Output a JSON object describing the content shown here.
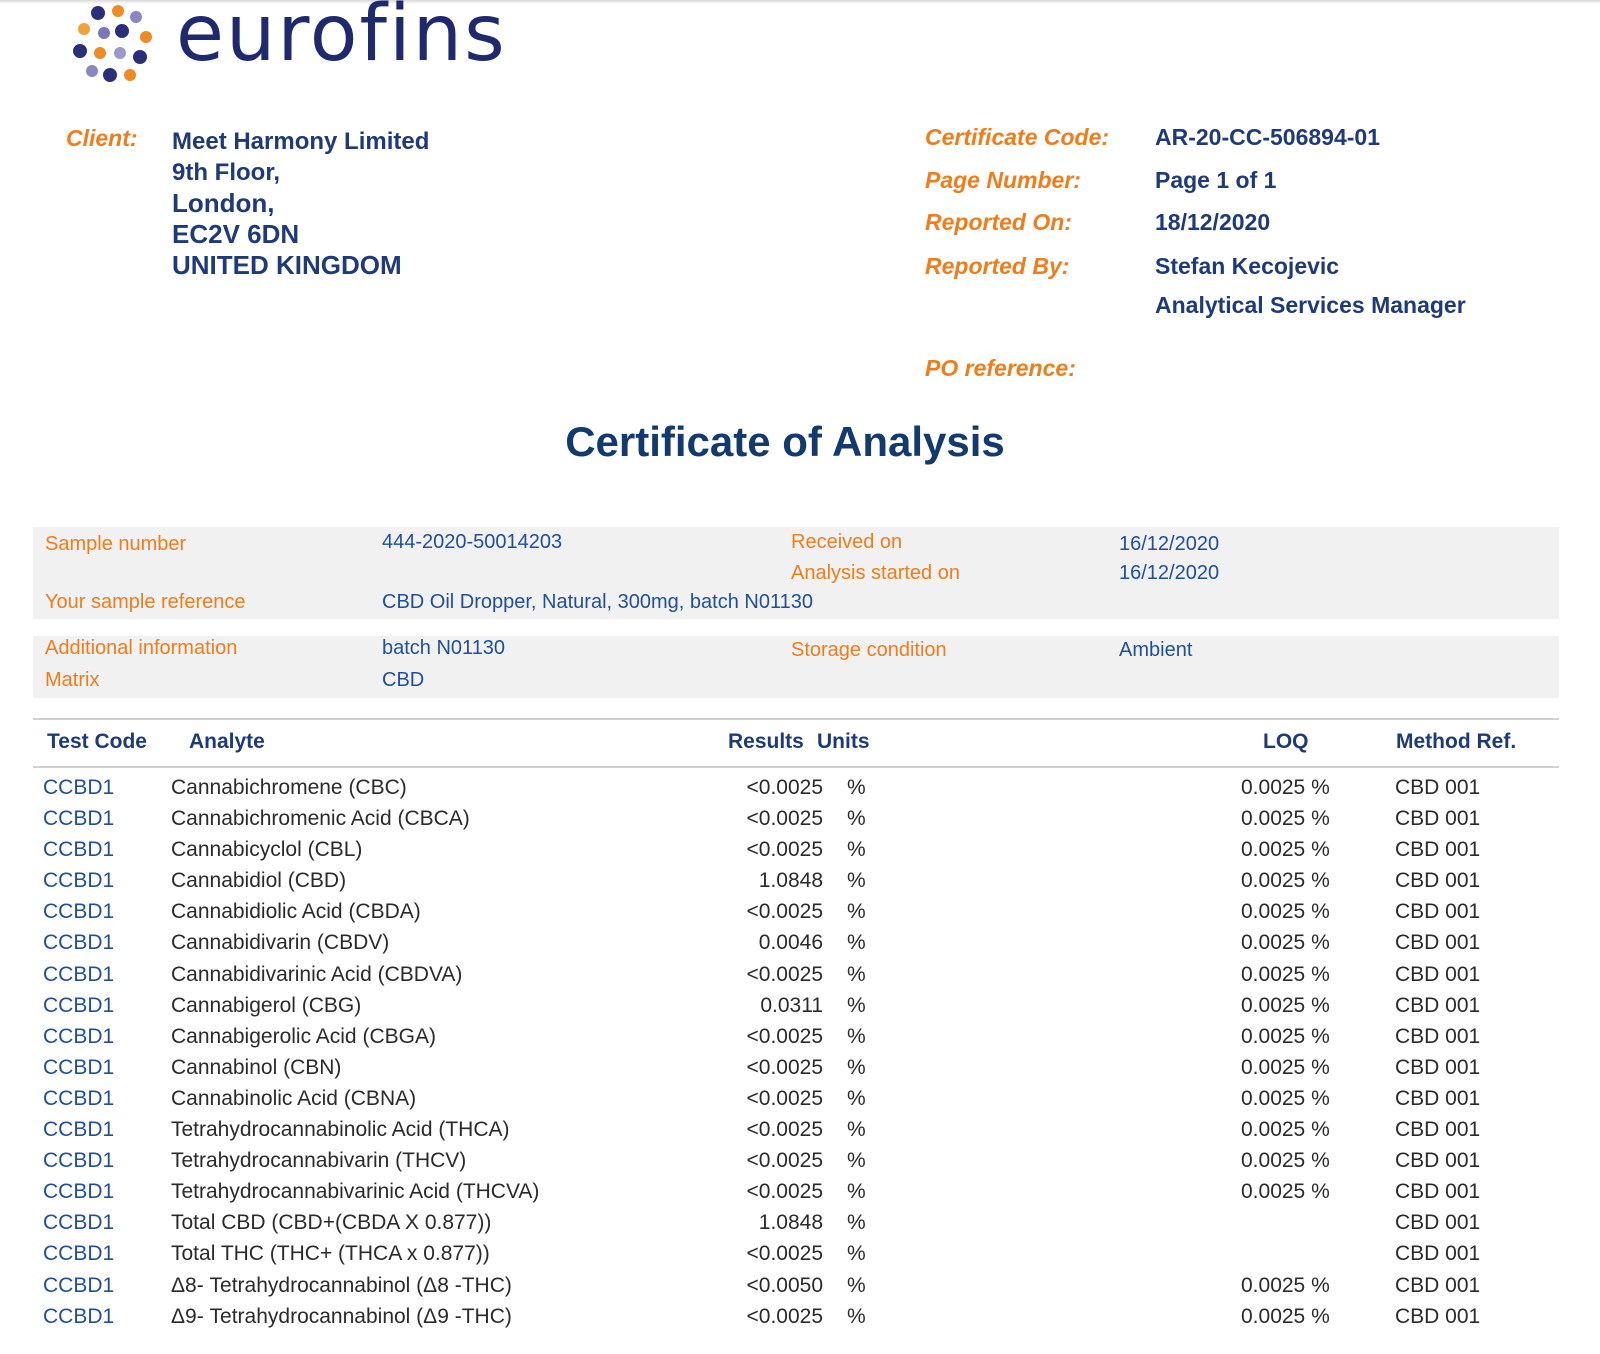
{
  "logo": {
    "text": "eurofins"
  },
  "client": {
    "label": "Client:",
    "lines": [
      "Meet Harmony Limited",
      "9th Floor,",
      "London,",
      "EC2V 6DN",
      "UNITED KINGDOM"
    ]
  },
  "certificate": {
    "code_label": "Certificate Code:",
    "code": "AR-20-CC-506894-01",
    "page_label": "Page Number:",
    "page": "Page 1 of 1",
    "reported_on_label": "Reported On:",
    "reported_on": "18/12/2020",
    "reported_by_label": "Reported By:",
    "reported_by": "Stefan Kecojevic",
    "reported_by_role": "Analytical Services Manager",
    "po_label": "PO reference:"
  },
  "title": "Certificate of Analysis",
  "sample": {
    "number_label": "Sample number",
    "number": "444-2020-50014203",
    "received_label": "Received on",
    "received": "16/12/2020",
    "started_label": "Analysis started on",
    "started": "16/12/2020",
    "reference_label": "Your sample reference",
    "reference": "CBD Oil Dropper, Natural, 300mg, batch N01130",
    "additional_label": "Additional information",
    "additional": "batch N01130",
    "storage_label": "Storage condition",
    "storage": "Ambient",
    "matrix_label": "Matrix",
    "matrix": "CBD"
  },
  "table": {
    "headers": {
      "test_code": "Test Code",
      "analyte": "Analyte",
      "results": "Results",
      "units": "Units",
      "loq": "LOQ",
      "method": "Method Ref."
    },
    "rows": [
      {
        "code": "CCBD1",
        "analyte": "Cannabichromene (CBC)",
        "result": "<0.0025",
        "unit": "%",
        "loq": "0.0025 %",
        "method": "CBD 001"
      },
      {
        "code": "CCBD1",
        "analyte": "Cannabichromenic Acid (CBCA)",
        "result": "<0.0025",
        "unit": "%",
        "loq": "0.0025 %",
        "method": "CBD 001"
      },
      {
        "code": "CCBD1",
        "analyte": "Cannabicyclol (CBL)",
        "result": "<0.0025",
        "unit": "%",
        "loq": "0.0025 %",
        "method": "CBD 001"
      },
      {
        "code": "CCBD1",
        "analyte": "Cannabidiol (CBD)",
        "result": "1.0848",
        "unit": "%",
        "loq": "0.0025 %",
        "method": "CBD 001"
      },
      {
        "code": "CCBD1",
        "analyte": "Cannabidiolic Acid (CBDA)",
        "result": "<0.0025",
        "unit": "%",
        "loq": "0.0025 %",
        "method": "CBD 001"
      },
      {
        "code": "CCBD1",
        "analyte": "Cannabidivarin (CBDV)",
        "result": "0.0046",
        "unit": "%",
        "loq": "0.0025 %",
        "method": "CBD 001"
      },
      {
        "code": "CCBD1",
        "analyte": "Cannabidivarinic Acid (CBDVA)",
        "result": "<0.0025",
        "unit": "%",
        "loq": "0.0025 %",
        "method": "CBD 001"
      },
      {
        "code": "CCBD1",
        "analyte": "Cannabigerol (CBG)",
        "result": "0.0311",
        "unit": "%",
        "loq": "0.0025 %",
        "method": "CBD 001"
      },
      {
        "code": "CCBD1",
        "analyte": "Cannabigerolic Acid (CBGA)",
        "result": "<0.0025",
        "unit": "%",
        "loq": "0.0025 %",
        "method": "CBD 001"
      },
      {
        "code": "CCBD1",
        "analyte": "Cannabinol (CBN)",
        "result": "<0.0025",
        "unit": "%",
        "loq": "0.0025 %",
        "method": "CBD 001"
      },
      {
        "code": "CCBD1",
        "analyte": "Cannabinolic Acid (CBNA)",
        "result": "<0.0025",
        "unit": "%",
        "loq": "0.0025 %",
        "method": "CBD 001"
      },
      {
        "code": "CCBD1",
        "analyte": "Tetrahydrocannabinolic Acid (THCA)",
        "result": "<0.0025",
        "unit": "%",
        "loq": "0.0025 %",
        "method": "CBD 001"
      },
      {
        "code": "CCBD1",
        "analyte": "Tetrahydrocannabivarin (THCV)",
        "result": "<0.0025",
        "unit": "%",
        "loq": "0.0025 %",
        "method": "CBD 001"
      },
      {
        "code": "CCBD1",
        "analyte": "Tetrahydrocannabivarinic Acid (THCVA)",
        "result": "<0.0025",
        "unit": "%",
        "loq": "0.0025 %",
        "method": "CBD 001"
      },
      {
        "code": "CCBD1",
        "analyte": "Total CBD (CBD+(CBDA X 0.877))",
        "result": "1.0848",
        "unit": "%",
        "loq": "",
        "method": "CBD 001"
      },
      {
        "code": "CCBD1",
        "analyte": "Total THC (THC+ (THCA x 0.877))",
        "result": "<0.0025",
        "unit": "%",
        "loq": "",
        "method": "CBD 001"
      },
      {
        "code": "CCBD1",
        "analyte": "Δ8- Tetrahydrocannabinol (Δ8 -THC)",
        "result": "<0.0050",
        "unit": "%",
        "loq": "0.0025 %",
        "method": "CBD 001"
      },
      {
        "code": "CCBD1",
        "analyte": "Δ9- Tetrahydrocannabinol (Δ9 -THC)",
        "result": "<0.0025",
        "unit": "%",
        "loq": "0.0025 %",
        "method": "CBD 001"
      }
    ]
  }
}
